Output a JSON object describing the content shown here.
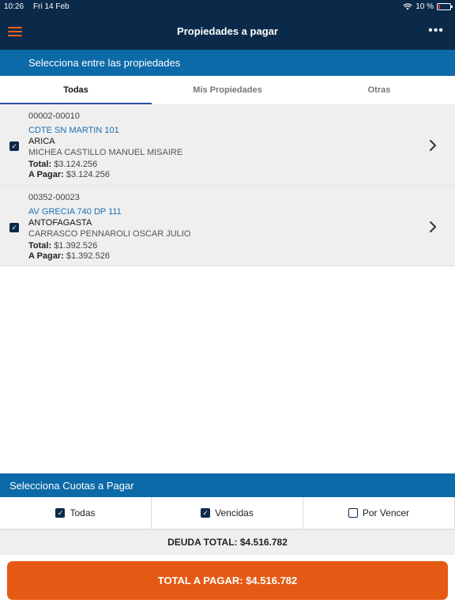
{
  "status_bar": {
    "time": "10:26",
    "date": "Fri 14 Feb",
    "battery": "10 %",
    "battery_level": 10
  },
  "nav": {
    "title": "Propiedades a pagar",
    "menu_icon": "hamburger-icon",
    "more_icon": "more-icon",
    "more_glyph": "•••"
  },
  "properties_section": {
    "header": "Selecciona entre las propiedades",
    "tabs": [
      {
        "label": "Todas",
        "active": true
      },
      {
        "label": "Mis Propiedades",
        "active": false
      },
      {
        "label": "Otras",
        "active": false
      }
    ],
    "items": [
      {
        "code": "00002-00010",
        "address": "CDTE SN MARTIN 101",
        "city": "ARICA",
        "owner": "MICHEA CASTILLO MANUEL MISAIRE",
        "total_label": "Total:",
        "total_value": "$3.124.256",
        "apagar_label": "A Pagar:",
        "apagar_value": "$3.124.256",
        "checked": true
      },
      {
        "code": "00352-00023",
        "address": "AV GRECIA 740 DP 111",
        "city": "ANTOFAGASTA",
        "owner": "CARRASCO PENNAROLI OSCAR JULIO",
        "total_label": "Total:",
        "total_value": "$1.392.526",
        "apagar_label": "A Pagar:",
        "apagar_value": "$1.392.526",
        "checked": true
      }
    ]
  },
  "cuotas_section": {
    "header": "Selecciona Cuotas a Pagar",
    "filters": [
      {
        "label": "Todas",
        "checked": true
      },
      {
        "label": "Vencidas",
        "checked": true
      },
      {
        "label": "Por Vencer",
        "checked": false
      }
    ]
  },
  "deuda_total": "DEUDA TOTAL: $4.516.782",
  "pay_button_label": "TOTAL A PAGAR: $4.516.782",
  "colors": {
    "navy": "#0b2a4a",
    "section_blue": "#0c6aa8",
    "accent_orange": "#e45a14",
    "link_blue": "#1a6fb0"
  }
}
